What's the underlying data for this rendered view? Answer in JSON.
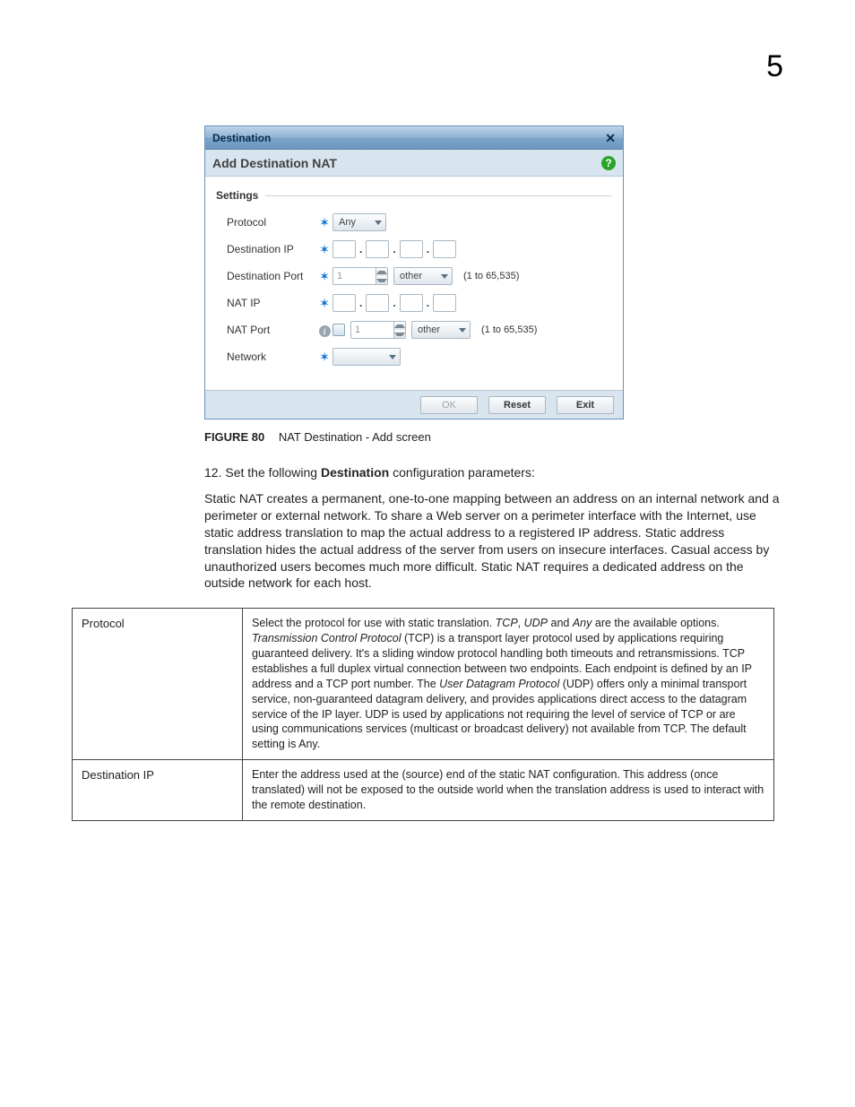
{
  "page_number": "5",
  "dialog": {
    "title": "Destination",
    "subtitle": "Add Destination NAT",
    "section_label": "Settings",
    "rows": {
      "protocol": {
        "label": "Protocol",
        "value": "Any"
      },
      "dest_ip": {
        "label": "Destination IP"
      },
      "dest_port": {
        "label": "Destination Port",
        "value": "1",
        "unit_option": "other",
        "range": "(1 to 65,535)"
      },
      "nat_ip": {
        "label": "NAT IP"
      },
      "nat_port": {
        "label": "NAT Port",
        "value": "1",
        "unit_option": "other",
        "range": "(1 to 65,535)"
      },
      "network": {
        "label": "Network"
      }
    },
    "buttons": {
      "ok": "OK",
      "reset": "Reset",
      "exit": "Exit"
    }
  },
  "figure": {
    "label": "FIGURE 80",
    "caption": "NAT Destination - Add screen"
  },
  "step": {
    "number": "12.",
    "text_prefix": "Set the following ",
    "bold": "Destination",
    "text_suffix": " configuration parameters:"
  },
  "paragraph": "Static NAT creates a permanent, one-to-one mapping between an address on an internal network and a perimeter or external network. To share a Web server on a perimeter interface with the Internet, use static address translation to map the actual address to a registered IP address. Static address translation hides the actual address of the server from users on insecure interfaces. Casual access by unauthorized users becomes much more difficult. Static NAT requires a dedicated address on the outside network for each host.",
  "table": {
    "rows": [
      {
        "key": "Protocol",
        "segments": [
          {
            "t": "Select the protocol for use with static translation. "
          },
          {
            "t": "TCP",
            "i": true
          },
          {
            "t": ", "
          },
          {
            "t": "UDP",
            "i": true
          },
          {
            "t": " and "
          },
          {
            "t": "Any",
            "i": true
          },
          {
            "t": " are the available options. "
          },
          {
            "t": "Transmission Control Protocol",
            "i": true
          },
          {
            "t": " (TCP) is a transport layer protocol used by applications requiring guaranteed delivery. It's a sliding window protocol handling both timeouts and retransmissions. TCP establishes a full duplex virtual connection between two endpoints. Each endpoint is defined by an IP address and a TCP port number. The "
          },
          {
            "t": "User Datagram Protocol",
            "i": true
          },
          {
            "t": " (UDP) offers only a minimal transport service, non-guaranteed datagram delivery, and provides applications direct access to the datagram service of the IP layer. UDP is used by applications not requiring the level of service of TCP or are using communications services (multicast or broadcast delivery) not available from TCP. The default setting is Any."
          }
        ]
      },
      {
        "key": "Destination IP",
        "segments": [
          {
            "t": "Enter the address used at the (source) end of the static NAT configuration. This address (once translated) will not be exposed to the outside world when the translation address is used to interact with the remote destination."
          }
        ]
      }
    ]
  }
}
